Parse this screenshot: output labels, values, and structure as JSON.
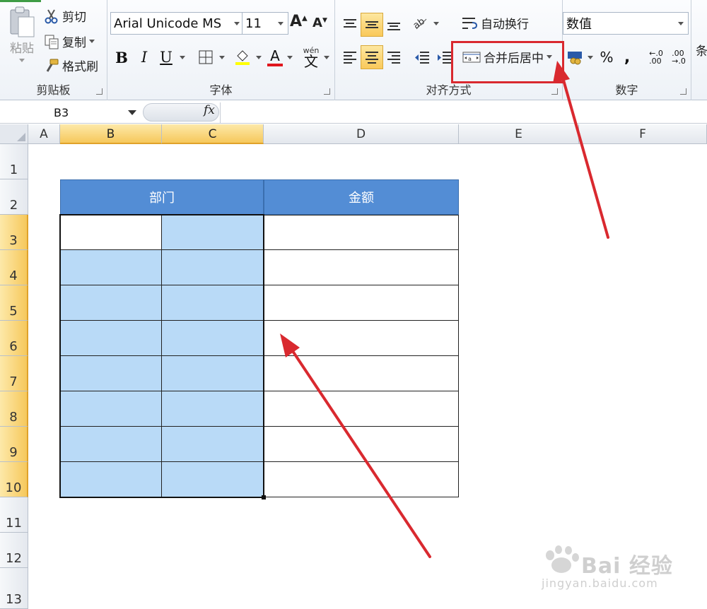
{
  "ribbon": {
    "clipboard": {
      "paste_label": "粘贴",
      "cut_label": "剪切",
      "copy_label": "复制",
      "format_painter_label": "格式刷",
      "group_label": "剪贴板"
    },
    "font": {
      "font_name": "Arial Unicode MS",
      "font_size": "11",
      "bold": "B",
      "italic": "I",
      "underline": "U",
      "font_color_glyph": "A",
      "group_label": "字体"
    },
    "alignment": {
      "wrap_text_label": "自动换行",
      "merge_center_label": "合并后居中",
      "group_label": "对齐方式"
    },
    "number": {
      "format_value": "数值",
      "percent": "%",
      "comma": ",",
      "group_label": "数字"
    },
    "partial_label": "条"
  },
  "formula_bar": {
    "name_box": "B3",
    "fx_label": "fx",
    "formula": ""
  },
  "sheet": {
    "columns": [
      "A",
      "B",
      "C",
      "D",
      "E",
      "F"
    ],
    "rows": [
      "1",
      "2",
      "3",
      "4",
      "5",
      "6",
      "7",
      "8",
      "9",
      "10",
      "11",
      "12",
      "13"
    ],
    "table_header": {
      "dept": "部门",
      "amount": "金额"
    }
  },
  "colors": {
    "header_fill": "#538dd5",
    "selection_fill": "#b9daf7",
    "annotation_red": "#d9292f"
  },
  "watermark": {
    "brand": "Bai 经验",
    "url": "jingyan.baidu.com"
  }
}
